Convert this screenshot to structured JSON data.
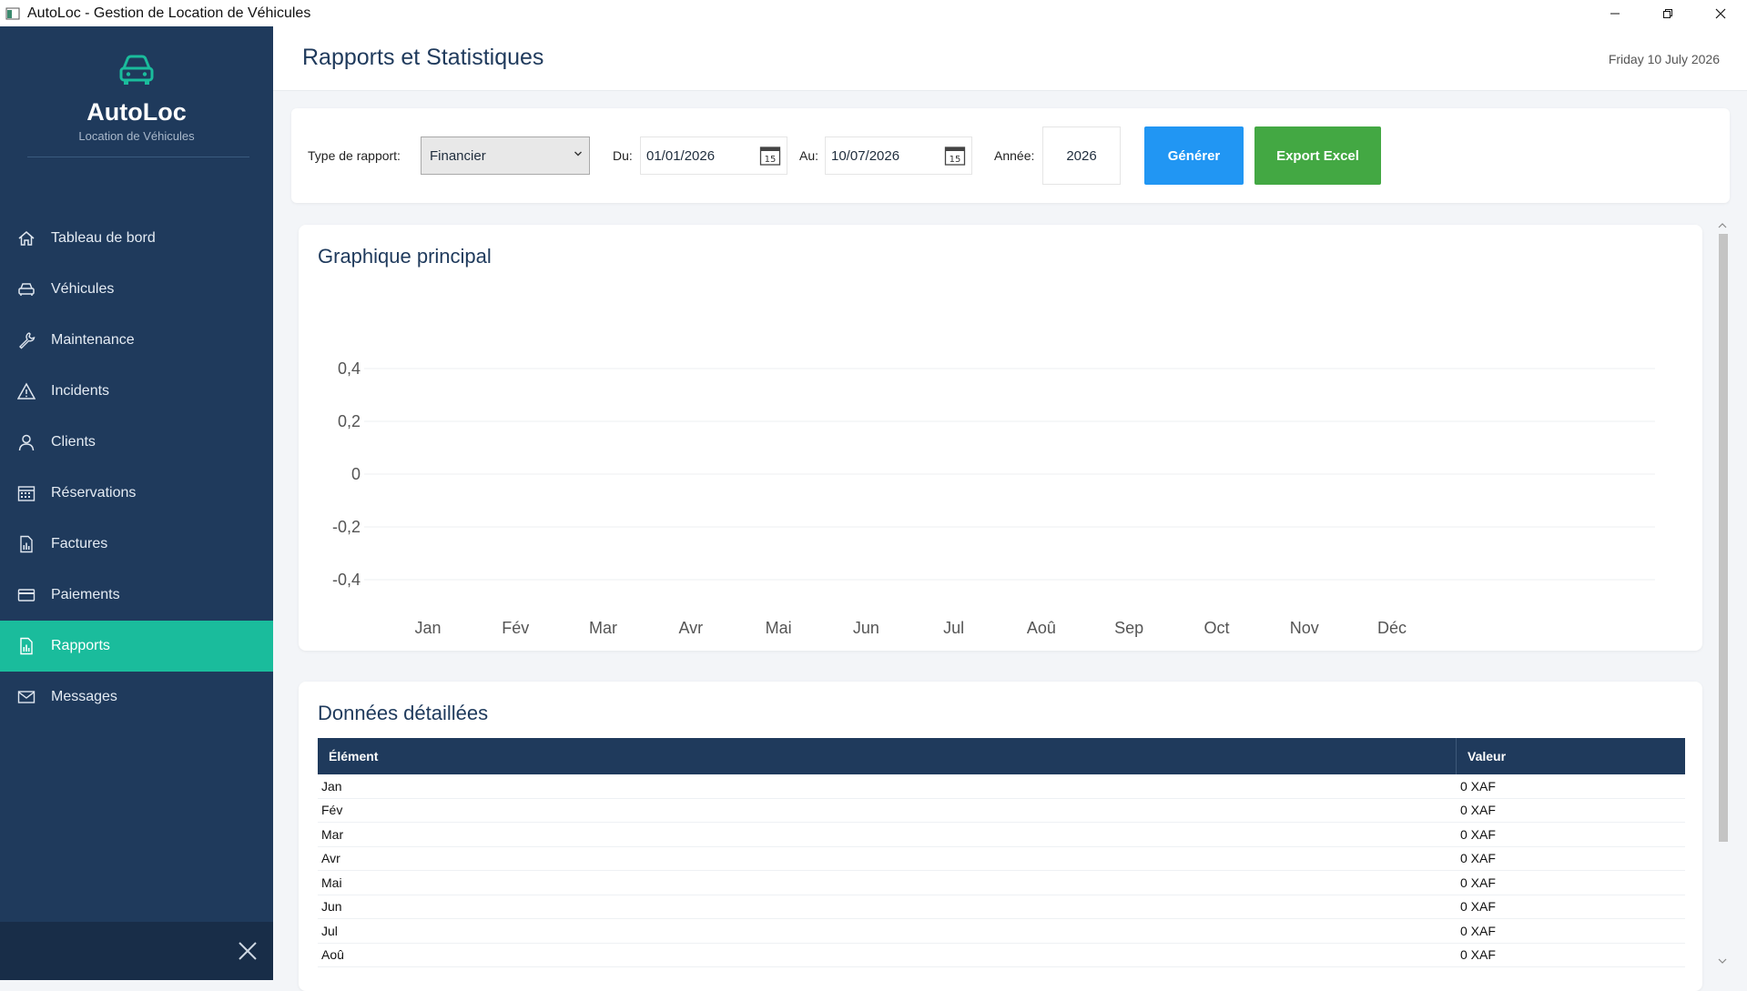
{
  "window": {
    "title": "AutoLoc - Gestion de Location de Véhicules"
  },
  "brand": {
    "name": "AutoLoc",
    "subtitle": "Location de Véhicules"
  },
  "nav": [
    {
      "label": "Tableau de bord",
      "icon": "home-icon",
      "active": false
    },
    {
      "label": "Véhicules",
      "icon": "car-icon",
      "active": false
    },
    {
      "label": "Maintenance",
      "icon": "wrench-icon",
      "active": false
    },
    {
      "label": "Incidents",
      "icon": "warning-icon",
      "active": false
    },
    {
      "label": "Clients",
      "icon": "user-icon",
      "active": false
    },
    {
      "label": "Réservations",
      "icon": "calendar-icon",
      "active": false
    },
    {
      "label": "Factures",
      "icon": "invoice-icon",
      "active": false
    },
    {
      "label": "Paiements",
      "icon": "card-icon",
      "active": false
    },
    {
      "label": "Rapports",
      "icon": "report-icon",
      "active": true
    },
    {
      "label": "Messages",
      "icon": "mail-icon",
      "active": false
    }
  ],
  "header": {
    "title": "Rapports et Statistiques",
    "date": "Friday 10 July 2026"
  },
  "filters": {
    "type_label": "Type de rapport:",
    "type_value": "Financier",
    "from_label": "Du:",
    "from_value": "01/01/2026",
    "to_label": "Au:",
    "to_value": "10/07/2026",
    "year_label": "Année:",
    "year_value": "2026",
    "calendar_day": "15",
    "generate_label": "Générer",
    "export_label": "Export Excel"
  },
  "chart_card": {
    "title": "Graphique principal"
  },
  "chart_data": {
    "type": "line",
    "categories": [
      "Jan",
      "Fév",
      "Mar",
      "Avr",
      "Mai",
      "Jun",
      "Jul",
      "Aoû",
      "Sep",
      "Oct",
      "Nov",
      "Déc"
    ],
    "y_ticks": [
      "0,4",
      "0,2",
      "0",
      "-0,2",
      "-0,4"
    ],
    "ylim": [
      -0.4,
      0.4
    ],
    "grid": true,
    "title": "",
    "xlabel": "",
    "ylabel": ""
  },
  "table_card": {
    "title": "Données détaillées",
    "columns": [
      "Élément",
      "Valeur"
    ],
    "rows": [
      [
        "Jan",
        "0 XAF"
      ],
      [
        "Fév",
        "0 XAF"
      ],
      [
        "Mar",
        "0 XAF"
      ],
      [
        "Avr",
        "0 XAF"
      ],
      [
        "Mai",
        "0 XAF"
      ],
      [
        "Jun",
        "0 XAF"
      ],
      [
        "Jul",
        "0 XAF"
      ],
      [
        "Aoû",
        "0 XAF"
      ]
    ]
  },
  "colors": {
    "sidebar": "#1f3a5c",
    "active": "#1abc9c",
    "generate": "#2196f3",
    "export": "#43a843"
  }
}
